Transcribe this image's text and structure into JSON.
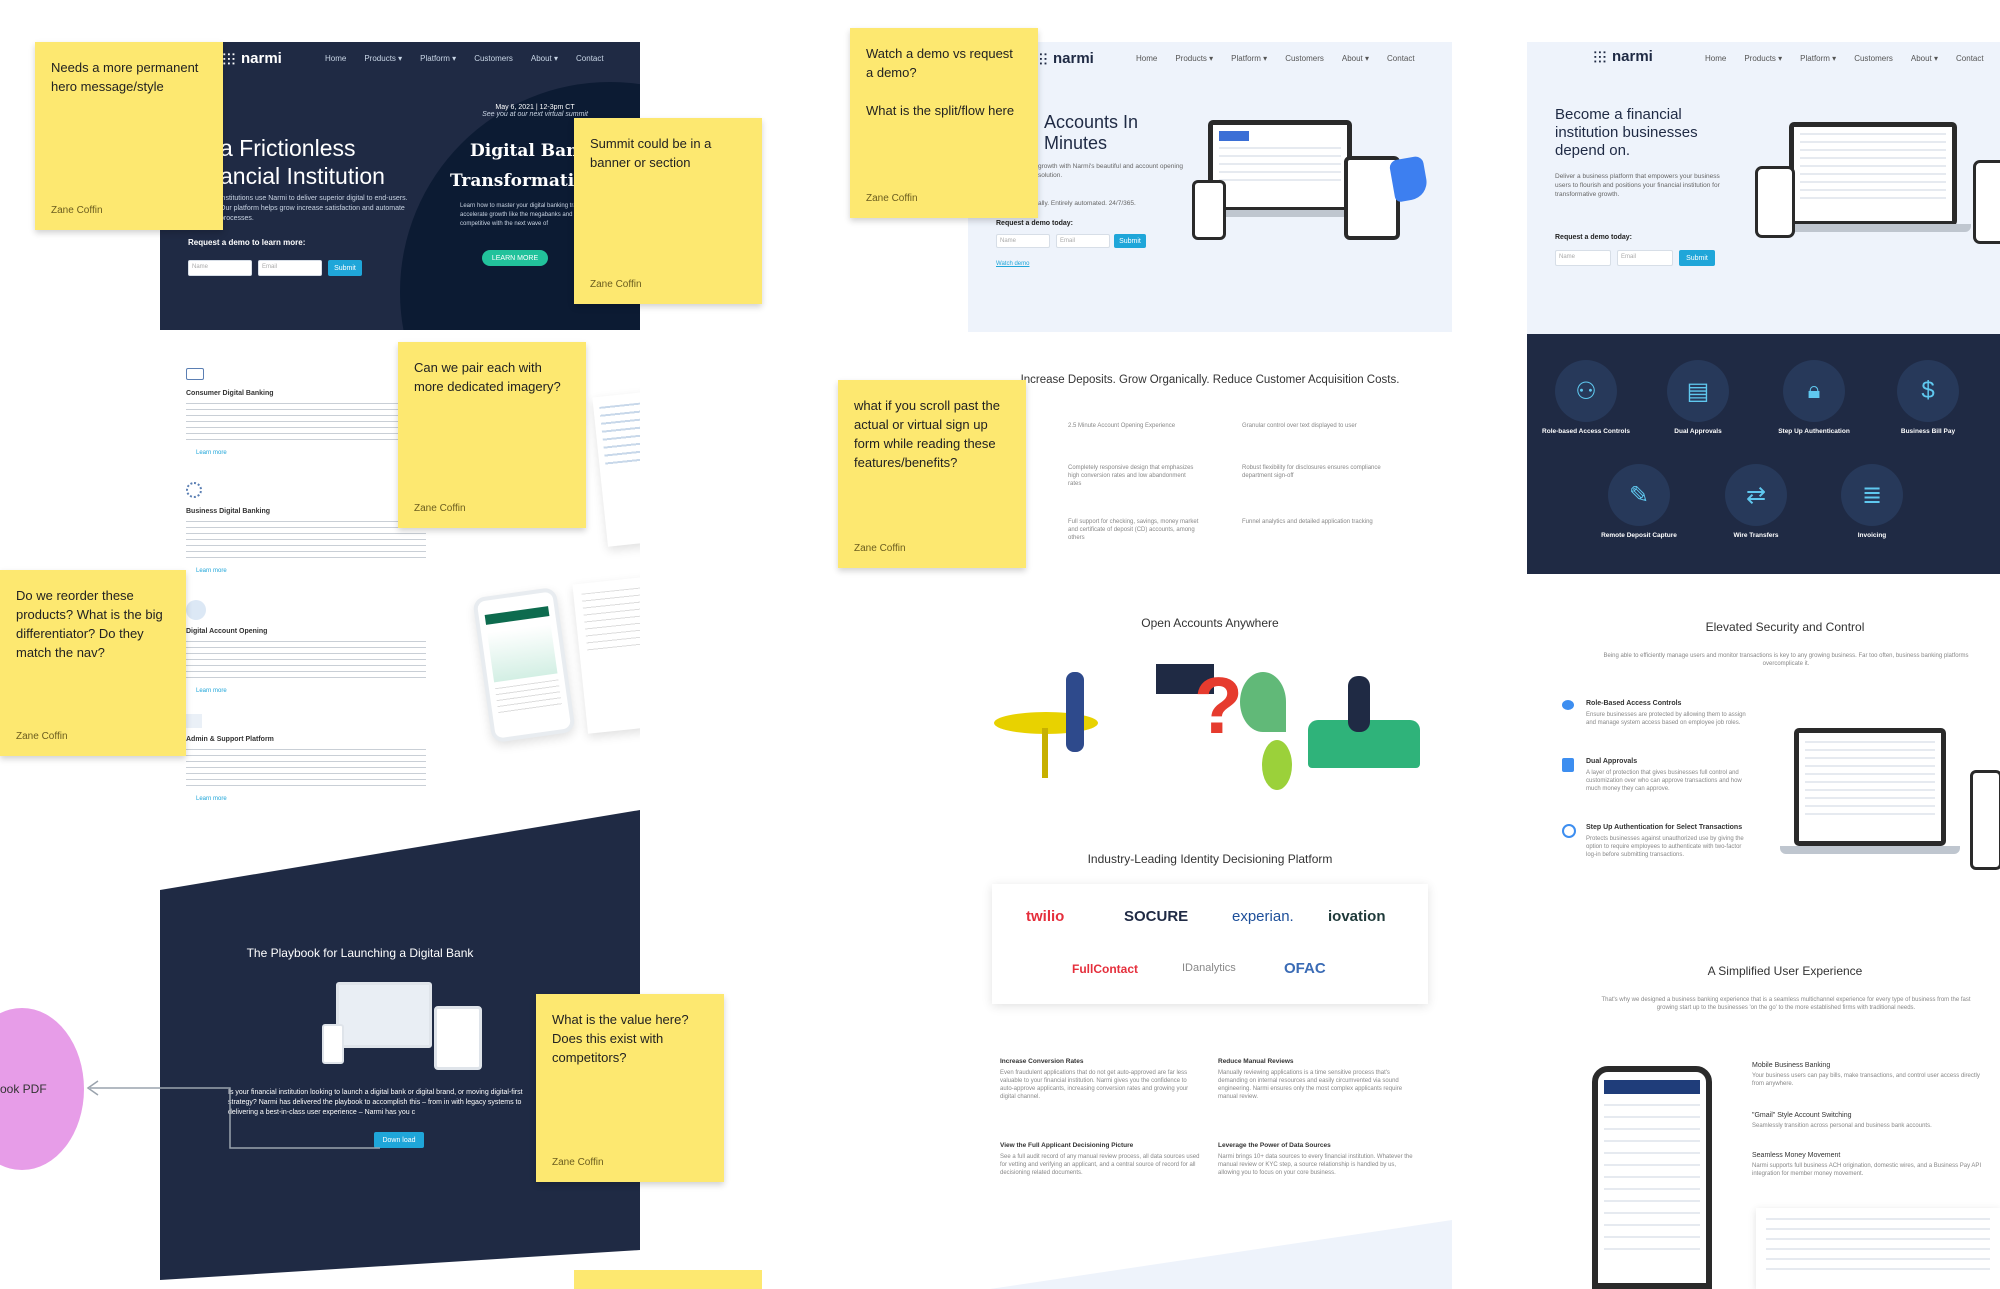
{
  "brand": {
    "name": "narmi"
  },
  "stickies": [
    {
      "text": "Needs a more permanent\nhero message/style",
      "author": "Zane Coffin"
    },
    {
      "text": "Summit could be in a\nbanner or section",
      "author": "Zane Coffin"
    },
    {
      "text": "Can we pair each with\nmore dedicated imagery?",
      "author": "Zane Coffin"
    },
    {
      "text": "Do we reorder these\nproducts? What is the big\ndifferentiator? Do they\nmatch the nav?",
      "author": "Zane Coffin"
    },
    {
      "text": "What is the value here?\nDoes this exist with\ncompetitors?",
      "author": "Zane Coffin"
    },
    {
      "text": "Watch a demo vs request\na demo?\n\nWhat is the split/flow here",
      "author": "Zane Coffin"
    },
    {
      "text": "what if you scroll past the\nactual or virtual sign up\nform while reading these\nfeatures/benefits?",
      "author": "Zane Coffin"
    }
  ],
  "pdf_bubble": {
    "label": "ook PDF"
  },
  "nav": [
    "Home",
    "Products ▾",
    "Platform ▾",
    "Customers",
    "About ▾",
    "Contact"
  ],
  "frame1": {
    "hero_title_1": "a Frictionless",
    "hero_title_2": "ancial Institution",
    "hero_desc": "institutions use Narmi to deliver superior digital to end-users. Our platform helps grow increase satisfaction and automate processes.",
    "demo_label": "Request a demo to learn more:",
    "name_ph": "Name",
    "email_ph": "Email",
    "submit": "Submit",
    "event_date": "May 6, 2021 | 12-3pm CT",
    "event_sub": "See you at our next virtual summit",
    "summit_1": "Digital Bankin",
    "summit_2": "Transformation Su",
    "summit_desc": "Learn how to master your digital banking transf accelerate growth like the megabanks and stay competitive with the next wave of",
    "learn_more": "LEARN MORE"
  },
  "products": [
    {
      "title": "Consumer Digital Banking",
      "link": "Learn more"
    },
    {
      "title": "Business Digital Banking",
      "link": "Learn more"
    },
    {
      "title": "Digital Account Opening",
      "link": "Learn more"
    },
    {
      "title": "Admin & Support Platform",
      "link": "Learn more"
    }
  ],
  "playbook": {
    "title": "The Playbook for Launching a Digital Bank",
    "desc": "Is your financial institution looking to launch a digital bank or digital brand, or moving digital-first strategy? Narmi has delivered the playbook to accomplish this – from in with legacy systems to delivering a best-in-class user experience – Narmi has you c",
    "button": "Down load"
  },
  "frame2": {
    "hero_title_1": "Accounts In",
    "hero_title_2": "Minutes",
    "hero_desc": "growth with Narmi's beautiful and account opening solution.",
    "hero_desc2": "ally. Entirely automated. 24/7/365.",
    "demo_label": "Request a demo today:",
    "watch": "Watch demo",
    "submit": "Submit",
    "name_ph": "Name",
    "email_ph": "Email",
    "headline": "Increase Deposits. Grow Organically. Reduce Customer Acquisition Costs.",
    "bullets": [
      "2.5 Minute Account Opening Experience",
      "Granular control over text displayed to user",
      "Completely responsive design that emphasizes high conversion rates and low abandonment rates",
      "Robust flexibility for disclosures ensures compliance department sign-off",
      "Full support for checking, savings, money market and certificate of deposit (CD) accounts, among others",
      "Funnel analytics and detailed application tracking"
    ],
    "open_anywhere": "Open Accounts Anywhere",
    "identity": "Industry-Leading Identity Decisioning Platform",
    "partners": [
      "twilio",
      "SOCURE",
      "experian.",
      "iovation",
      "FullContact",
      "IDanalytics",
      "OFAC"
    ],
    "benefits": [
      {
        "title": "Increase Conversion Rates",
        "desc": "Even fraudulent applications that do not get auto-approved are far less valuable to your financial institution. Narmi gives you the confidence to auto-approve applicants, increasing conversion rates and growing your digital channel."
      },
      {
        "title": "Reduce Manual Reviews",
        "desc": "Manually reviewing applications is a time sensitive process that's demanding on internal resources and easily circumvented via sound engineering. Narmi ensures only the most complex applicants require manual review."
      },
      {
        "title": "View the Full Applicant Decisioning Picture",
        "desc": "See a full audit record of any manual review process, all data sources used for vetting and verifying an applicant, and a central source of record for all decisioning related documents."
      },
      {
        "title": "Leverage the Power of Data Sources",
        "desc": "Narmi brings 10+ data sources to every financial institution. Whatever the manual review or KYC step, a source relationship is handled by us, allowing you to focus on your core business."
      }
    ]
  },
  "frame3": {
    "hero_title": "Become a financial institution businesses depend on.",
    "hero_desc": "Deliver a business platform that empowers your business users to flourish and positions your financial institution for transformative growth.",
    "demo_label": "Request a demo today:",
    "submit": "Submit",
    "name_ph": "Name",
    "email_ph": "Email",
    "features": [
      "Role-based Access Controls",
      "Dual Approvals",
      "Step Up Authentication",
      "Business Bill Pay",
      "Remote Deposit Capture",
      "Wire Transfers",
      "Invoicing"
    ],
    "security_title": "Elevated Security and Control",
    "security_desc": "Being able to efficiently manage users and monitor transactions is key to any growing business. Far too often, business banking platforms overcomplicate it.",
    "security_items": [
      {
        "title": "Role-Based Access Controls",
        "desc": "Ensure businesses are protected by allowing them to assign and manage system access based on employee job roles."
      },
      {
        "title": "Dual Approvals",
        "desc": "A layer of protection that gives businesses full control and customization over who can approve transactions and how much money they can approve."
      },
      {
        "title": "Step Up Authentication for Select Transactions",
        "desc": "Protects businesses against unauthorized use by giving the option to require employees to authenticate with two-factor log-in before submitting transactions."
      }
    ],
    "ux_title": "A Simplified User Experience",
    "ux_desc": "That's why we designed a business banking experience that is a seamless multichannel experience for every type of business from the fast growing start up to the businesses 'on the go' to the more established firms with traditional needs.",
    "ux_items": [
      {
        "title": "Mobile Business Banking",
        "desc": "Your business users can pay bills, make transactions, and control user access directly from anywhere."
      },
      {
        "title": "\"Gmail\" Style Account Switching",
        "desc": "Seamlessly transition across personal and business bank accounts."
      },
      {
        "title": "Seamless Money Movement",
        "desc": "Narmi supports full business ACH origination, domestic wires, and a Business Pay API integration for member money movement."
      }
    ]
  }
}
